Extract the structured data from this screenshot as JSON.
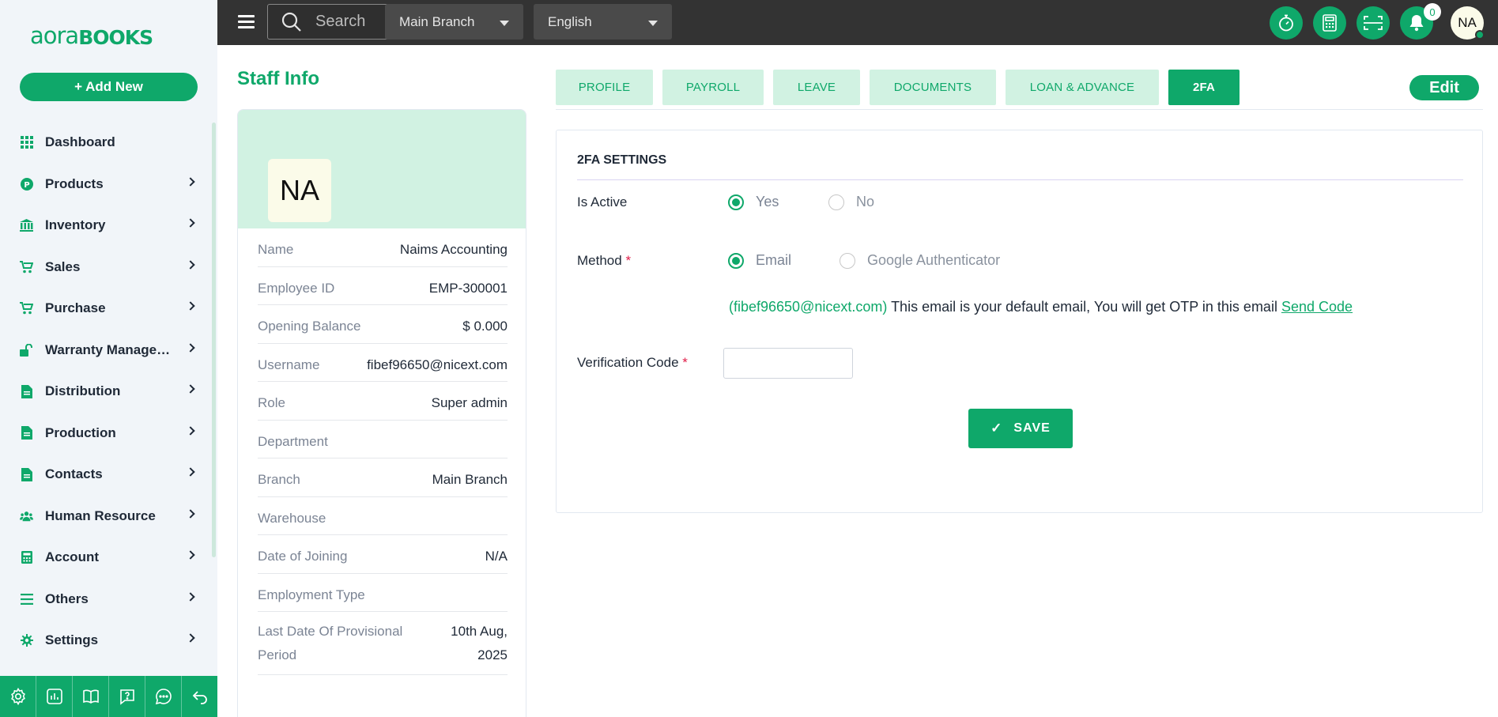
{
  "brand": {
    "logo_part1": "aora",
    "logo_part2": "BOOKS",
    "accent": "#0fa86a"
  },
  "sidebar": {
    "add_new_label": "+ Add New",
    "items": [
      {
        "label": "Dashboard",
        "icon": "grid-icon",
        "chevron": false
      },
      {
        "label": "Products",
        "icon": "product-icon",
        "chevron": true
      },
      {
        "label": "Inventory",
        "icon": "bank-icon",
        "chevron": true
      },
      {
        "label": "Sales",
        "icon": "cart-icon",
        "chevron": true
      },
      {
        "label": "Purchase",
        "icon": "cart-icon",
        "chevron": true
      },
      {
        "label": "Warranty Management",
        "icon": "unlock-icon",
        "chevron": true
      },
      {
        "label": "Distribution",
        "icon": "document-icon",
        "chevron": true
      },
      {
        "label": "Production",
        "icon": "document-icon",
        "chevron": true
      },
      {
        "label": "Contacts",
        "icon": "document-icon",
        "chevron": true
      },
      {
        "label": "Human Resource",
        "icon": "users-icon",
        "chevron": true
      },
      {
        "label": "Account",
        "icon": "calculator-icon",
        "chevron": true
      },
      {
        "label": "Others",
        "icon": "list-icon",
        "chevron": true
      },
      {
        "label": "Settings",
        "icon": "gear-icon",
        "chevron": true
      }
    ],
    "bottom_icons": [
      "gear-icon",
      "chart-icon",
      "book-icon",
      "help-icon",
      "chat-icon",
      "logout-icon"
    ]
  },
  "topbar": {
    "search_placeholder": "Search",
    "branch": "Main Branch",
    "language": "English",
    "notification_count": "0",
    "user_initials": "NA"
  },
  "staff": {
    "page_title": "Staff Info",
    "avatar_initials": "NA",
    "fields": [
      {
        "label": "Name",
        "value": "Naims Accounting"
      },
      {
        "label": "Employee ID",
        "value": "EMP-300001"
      },
      {
        "label": "Opening Balance",
        "value": "$ 0.000"
      },
      {
        "label": "Username",
        "value": "fibef96650@nicext.com"
      },
      {
        "label": "Role",
        "value": "Super admin"
      },
      {
        "label": "Department",
        "value": ""
      },
      {
        "label": "Branch",
        "value": "Main Branch"
      },
      {
        "label": "Warehouse",
        "value": ""
      },
      {
        "label": "Date of Joining",
        "value": "N/A"
      },
      {
        "label": "Employment Type",
        "value": ""
      },
      {
        "label": "Last Date Of Provisional Period",
        "value": "10th Aug, 2025"
      }
    ]
  },
  "tabs": [
    {
      "label": "PROFILE",
      "active": false
    },
    {
      "label": "PAYROLL",
      "active": false
    },
    {
      "label": "LEAVE",
      "active": false
    },
    {
      "label": "DOCUMENTS",
      "active": false
    },
    {
      "label": "LOAN & ADVANCE",
      "active": false
    },
    {
      "label": "2FA",
      "active": true
    }
  ],
  "edit_label": "Edit",
  "twofa": {
    "title": "2FA SETTINGS",
    "is_active_label": "Is Active",
    "yes_label": "Yes",
    "no_label": "No",
    "is_active_value": "Yes",
    "method_label": "Method",
    "method_email_label": "Email",
    "method_google_label": "Google Authenticator",
    "method_value": "Email",
    "email": "(fibef96650@nicext.com)",
    "email_note": "This email is your default email, You will get OTP in this email",
    "send_code_label": "Send Code",
    "verification_label": "Verification Code",
    "verification_value": "",
    "required_mark": "*",
    "save_label": "SAVE"
  }
}
